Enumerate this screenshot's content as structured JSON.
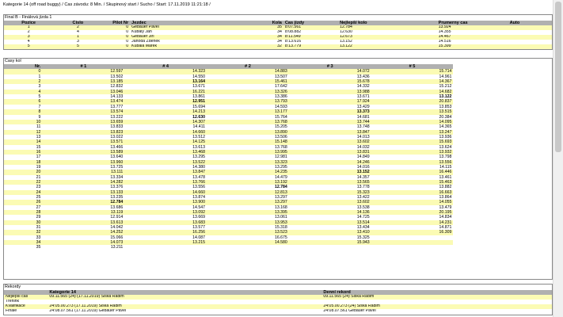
{
  "header": "Kategorie 14 (off road buggy) / Cas závodu: 8 Min. / Skupinový start / Sucho / Start: 17.11.2019 11:21:18 /",
  "final": {
    "title": "Final B - Finálová jízda 1",
    "columns": [
      "Pozice",
      "Cislo",
      "Pilot Nr",
      "Jezdec",
      "Kola",
      "Cas jizdy",
      "Nejlepší kolo",
      "Prumerny cas",
      "Auto"
    ],
    "rows": [
      [
        "1",
        "2",
        "0",
        "Gebauer Pavel",
        "35",
        "8:07.561",
        "12.784",
        "13.924",
        ""
      ],
      [
        "2",
        "4",
        "0",
        "Kubalý Jan",
        "34",
        "8:08.882",
        "12.630",
        "14.355",
        ""
      ],
      [
        "3",
        "1",
        "0",
        "Gebauer Jirí",
        "34",
        "8:11.549",
        "12.673",
        "14.467",
        ""
      ],
      [
        "4",
        "3",
        "0",
        "Jahoda Zdenek",
        "34",
        "8:13.616",
        "13.152",
        "14.516",
        ""
      ],
      [
        "5",
        "5",
        "0",
        "Kubala Marek",
        "32",
        "8:13.779",
        "13.122",
        "15.399",
        ""
      ]
    ]
  },
  "laps": {
    "title": "Casy kol",
    "columns": [
      "Nr.",
      "# 1",
      "# 4",
      "# 2",
      "# 3",
      "# 5"
    ],
    "rows": [
      [
        "0",
        "12.597",
        "14.323",
        "14.883",
        "14.072",
        "15.714"
      ],
      [
        "1",
        "13.502",
        "14.550",
        "13.507",
        "13.436",
        "14.961"
      ],
      [
        "2",
        "13.185",
        "13.164",
        "15.461",
        "15.678",
        "14.367"
      ],
      [
        "3",
        "12.832",
        "13.671",
        "17.642",
        "14.332",
        "15.212"
      ],
      [
        "4",
        "13.046",
        "16.221",
        "13.326",
        "13.988",
        "14.682"
      ],
      [
        "5",
        "14.133",
        "13.861",
        "13.386",
        "13.671",
        "13.122"
      ],
      [
        "6",
        "13.474",
        "12.951",
        "13.793",
        "17.924",
        "20.837"
      ],
      [
        "7",
        "13.777",
        "15.694",
        "14.593",
        "13.429",
        "13.853"
      ],
      [
        "8",
        "13.574",
        "14.213",
        "13.177",
        "13.373",
        "13.515"
      ],
      [
        "9",
        "13.222",
        "12.630",
        "15.764",
        "14.681",
        "20.384"
      ],
      [
        "10",
        "13.659",
        "14.307",
        "13.768",
        "13.744",
        "14.095"
      ],
      [
        "11",
        "13.833",
        "14.411",
        "15.205",
        "13.748",
        "14.365"
      ],
      [
        "12",
        "13.823",
        "14.660",
        "13.890",
        "13.847",
        "13.247"
      ],
      [
        "13",
        "13.022",
        "13.512",
        "13.506",
        "14.013",
        "13.936"
      ],
      [
        "14",
        "13.571",
        "14.125",
        "15.148",
        "13.602",
        "15.693"
      ],
      [
        "15",
        "13.466",
        "13.613",
        "13.768",
        "14.032",
        "13.624"
      ],
      [
        "16",
        "13.589",
        "13.468",
        "13.995",
        "13.831",
        "13.932"
      ],
      [
        "17",
        "13.640",
        "13.295",
        "12.981",
        "14.849",
        "13.798"
      ],
      [
        "18",
        "13.960",
        "13.522",
        "13.323",
        "14.246",
        "13.556"
      ],
      [
        "19",
        "13.725",
        "14.380",
        "13.295",
        "14.016",
        "14.115"
      ],
      [
        "20",
        "13.111",
        "13.847",
        "14.235",
        "13.152",
        "16.446"
      ],
      [
        "21",
        "13.334",
        "13.478",
        "14.479",
        "14.357",
        "13.461"
      ],
      [
        "22",
        "14.282",
        "13.766",
        "13.192",
        "13.565",
        "15.463"
      ],
      [
        "23",
        "13.376",
        "13.556",
        "12.784",
        "13.778",
        "13.882"
      ],
      [
        "24",
        "13.133",
        "14.660",
        "12.813",
        "15.323",
        "16.663"
      ],
      [
        "25",
        "13.235",
        "13.874",
        "13.297",
        "13.422",
        "13.864"
      ],
      [
        "26",
        "12.784",
        "13.900",
        "13.297",
        "13.602",
        "14.055"
      ],
      [
        "27",
        "13.686",
        "14.547",
        "13.168",
        "13.538",
        "13.479"
      ],
      [
        "28",
        "13.119",
        "13.092",
        "13.395",
        "14.136",
        "20.195"
      ],
      [
        "29",
        "12.914",
        "13.669",
        "13.061",
        "14.725",
        "14.834"
      ],
      [
        "30",
        "13.613",
        "13.683",
        "13.953",
        "13.514",
        "14.231"
      ],
      [
        "31",
        "14.042",
        "13.577",
        "15.318",
        "13.434",
        "14.871"
      ],
      [
        "32",
        "14.252",
        "16.256",
        "13.523",
        "13.410",
        "16.309"
      ],
      [
        "33",
        "15.066",
        "14.087",
        "16.675",
        "15.325",
        ""
      ],
      [
        "34",
        "14.073",
        "13.215",
        "14.580",
        "15.943",
        ""
      ],
      [
        "35",
        "13.211",
        "",
        "",
        "",
        ""
      ]
    ],
    "bold_cells": [
      [
        5,
        5
      ],
      [
        9,
        2
      ],
      [
        20,
        4
      ],
      [
        23,
        3
      ],
      [
        26,
        1
      ],
      [
        2,
        2
      ],
      [
        6,
        2
      ],
      [
        8,
        4
      ]
    ]
  },
  "records": {
    "title": "Rekordy",
    "columns": [
      "",
      "Kategorie 14",
      "",
      "Denní rekord",
      ""
    ],
    "rows": [
      [
        "Nejlepší cas",
        "09.11.565 (24) (17.11.2019) Šiška Radim",
        "",
        "09.11.565 (24) Šiška Radim",
        ""
      ],
      [
        "Trénink",
        "",
        "",
        "",
        ""
      ],
      [
        "Kvalifikace",
        "24:05.00.273 (17.11.2019) Šiška Radim",
        "",
        "24:05.00.273 (24) Šiška Radim",
        ""
      ],
      [
        "Finále",
        "24:08.07.561 (17.11.2019) Gebauer Pavel",
        "",
        "24:08.07.561 Gebauer Pavel",
        ""
      ]
    ]
  }
}
